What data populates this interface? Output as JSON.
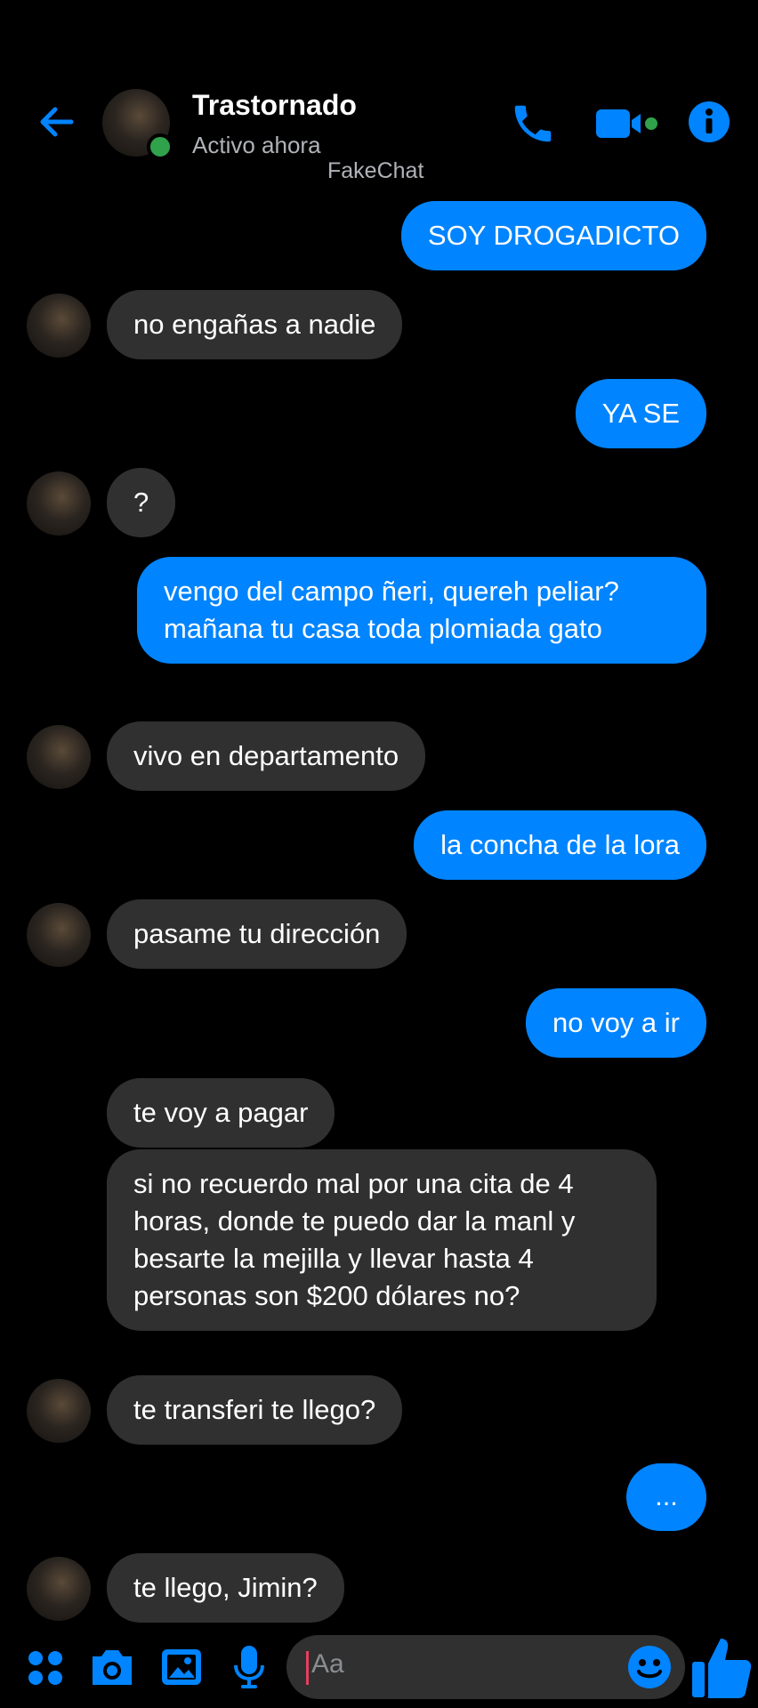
{
  "header": {
    "contact_name": "Trastornado",
    "status": "Activo ahora",
    "watermark": "FakeChat",
    "icons": [
      "back-arrow-icon",
      "phone-icon",
      "video-camera-icon",
      "info-icon"
    ]
  },
  "messages": [
    {
      "from": "me",
      "text": "SOY DROGADICTO"
    },
    {
      "from": "them",
      "text": "no engañas a nadie"
    },
    {
      "from": "me",
      "text": "YA SE"
    },
    {
      "from": "them",
      "text": "?"
    },
    {
      "from": "me",
      "text": "vengo del campo ñeri, quereh peliar? mañana tu casa toda plomiada gato"
    },
    {
      "from": "them",
      "text": "vivo en departamento"
    },
    {
      "from": "me",
      "text": "la concha de la lora"
    },
    {
      "from": "them",
      "text": "pasame tu dirección"
    },
    {
      "from": "me",
      "text": "no voy a ir"
    },
    {
      "from": "them",
      "text": "te voy a pagar"
    },
    {
      "from": "them",
      "text": "si no recuerdo mal por una cita de 4 horas, donde te puedo dar la manl y besarte la mejilla y llevar hasta 4 personas son $200 dólares no?"
    },
    {
      "from": "them",
      "text": "te transferi te llego?"
    },
    {
      "from": "me",
      "text": "..."
    },
    {
      "from": "them",
      "text": "te llego, Jimin?"
    }
  ],
  "composer": {
    "placeholder": "Aa",
    "icons": [
      "apps-icon",
      "camera-icon",
      "gallery-icon",
      "microphone-icon",
      "emoji-icon",
      "thumbs-up-icon"
    ]
  },
  "colors": {
    "accent": "#0084ff",
    "incoming_bubble": "#303030",
    "online": "#31a24c",
    "background": "#000000"
  }
}
